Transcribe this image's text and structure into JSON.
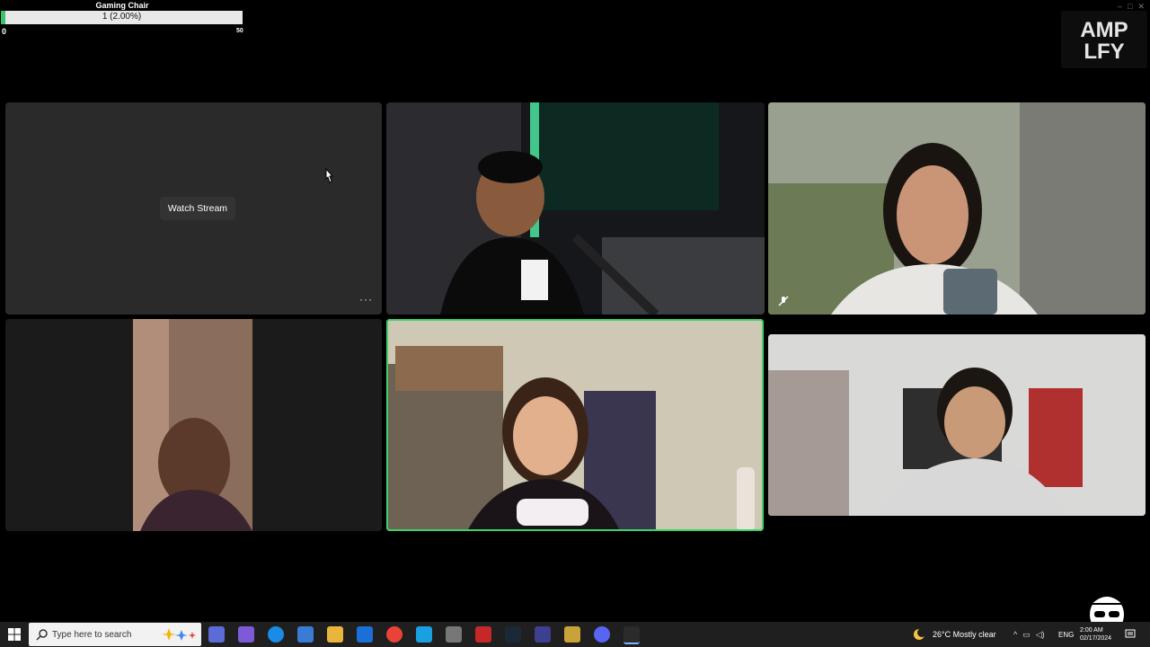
{
  "goal": {
    "title": "Gaming Chair",
    "progress_text": "1 (2.00%)",
    "progress_fraction": 0.02,
    "min": "0",
    "max": "50"
  },
  "brand": {
    "logo_line1": "AMP",
    "logo_line2": "LFY"
  },
  "tiles": {
    "stream": {
      "watch_label": "Watch Stream",
      "more_label": "···"
    }
  },
  "taskbar": {
    "search_placeholder": "Type here to search",
    "weather": "26°C  Mostly clear",
    "language": "ENG",
    "time": "2:00 AM",
    "date": "02/17/2024"
  },
  "colors": {
    "speaking_outline": "#3fd16a",
    "goal_fill": "#39c36b",
    "taskbar_bg": "#1f1f1f"
  }
}
